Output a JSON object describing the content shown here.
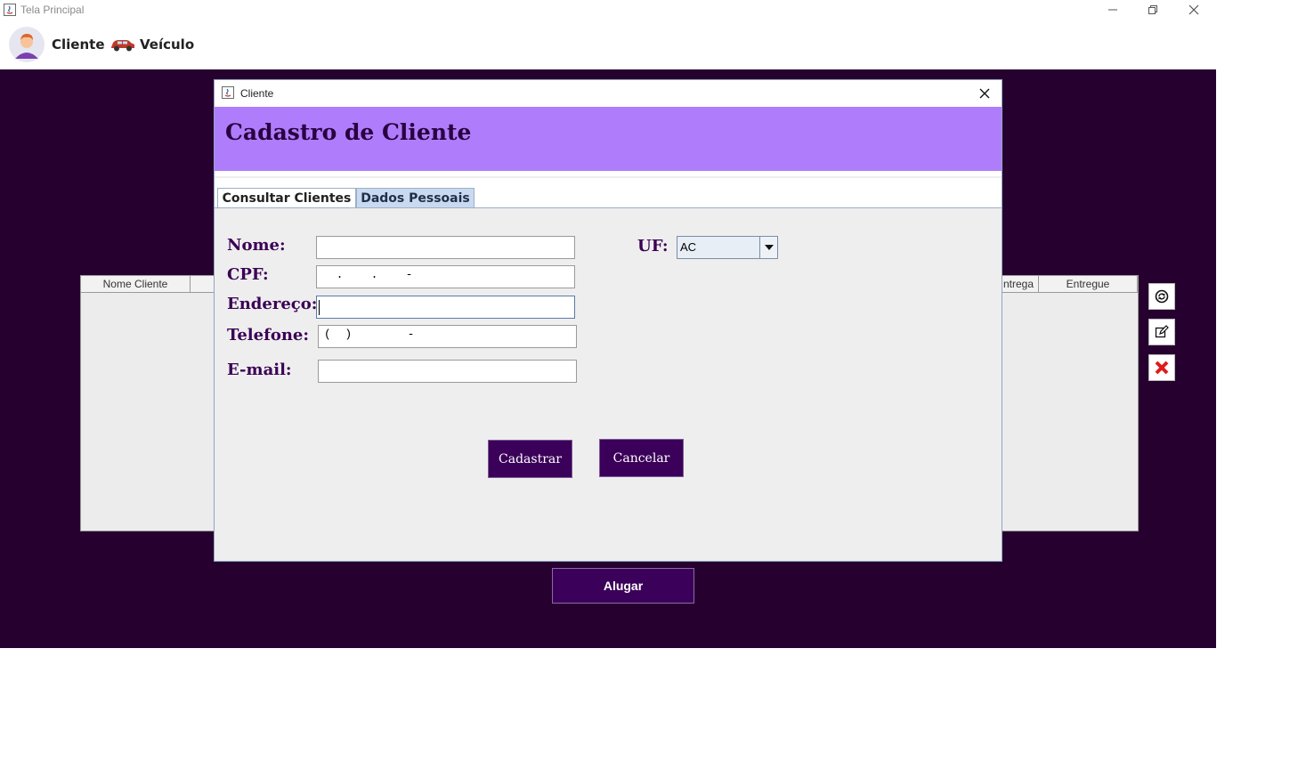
{
  "window": {
    "title": "Tela Principal"
  },
  "menu": {
    "cliente": "Cliente",
    "veiculo": "Veículo"
  },
  "table": {
    "col_nome_cliente": "Nome Cliente",
    "col_data_entrega": "ntrega",
    "col_entregue": "Entregue"
  },
  "main": {
    "alugar_label": "Alugar"
  },
  "dialog": {
    "title": "Cliente",
    "header": "Cadastro de Cliente",
    "tabs": [
      {
        "label": "Consultar Clientes"
      },
      {
        "label": "Dados Pessoais"
      }
    ],
    "form": {
      "nome_label": "Nome:",
      "nome_value": "",
      "cpf_label": "CPF:",
      "cpf_value": "  .    .    -",
      "endereco_label": "Endereço:",
      "endereco_value": "",
      "telefone_label": "Telefone:",
      "telefone_value": "(  )        -",
      "email_label": "E-mail:",
      "email_value": "",
      "uf_label": "UF:",
      "uf_value": "AC"
    },
    "buttons": {
      "cadastrar": "Cadastrar",
      "cancelar": "Cancelar"
    }
  },
  "colors": {
    "accent": "#3b0059",
    "header_bg": "#af7dfb",
    "desktop_bg": "#26002f",
    "label_color": "#3a0055"
  }
}
